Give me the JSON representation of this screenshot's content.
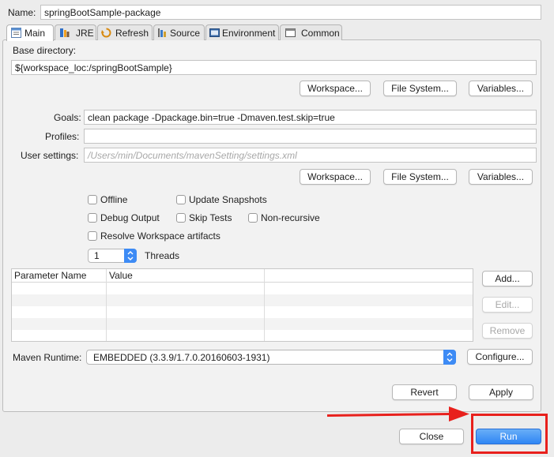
{
  "name_label": "Name:",
  "name_value": "springBootSample-package",
  "tabs": [
    {
      "label": "Main",
      "icon": "main-tab-icon"
    },
    {
      "label": "JRE",
      "icon": "jre-tab-icon"
    },
    {
      "label": "Refresh",
      "icon": "refresh-tab-icon"
    },
    {
      "label": "Source",
      "icon": "source-tab-icon"
    },
    {
      "label": "Environment",
      "icon": "environment-tab-icon"
    },
    {
      "label": "Common",
      "icon": "common-tab-icon"
    }
  ],
  "base_directory": {
    "label": "Base directory:",
    "value": "${workspace_loc:/springBootSample}",
    "buttons": [
      "Workspace...",
      "File System...",
      "Variables..."
    ]
  },
  "goals": {
    "label": "Goals:",
    "value": "clean package -Dpackage.bin=true -Dmaven.test.skip=true"
  },
  "profiles": {
    "label": "Profiles:",
    "value": ""
  },
  "user_settings": {
    "label": "User settings:",
    "placeholder": "/Users/min/Documents/mavenSetting/settings.xml",
    "buttons": [
      "Workspace...",
      "File System...",
      "Variables..."
    ]
  },
  "options": {
    "offline": "Offline",
    "update_snapshots": "Update Snapshots",
    "debug_output": "Debug Output",
    "skip_tests": "Skip Tests",
    "non_recursive": "Non-recursive",
    "resolve_workspace": "Resolve Workspace artifacts",
    "threads_value": "1",
    "threads_label": "Threads"
  },
  "parameters": {
    "columns": [
      "Parameter Name",
      "Value"
    ],
    "add": "Add...",
    "edit": "Edit...",
    "remove": "Remove"
  },
  "maven_runtime": {
    "label": "Maven Runtime:",
    "value": "EMBEDDED (3.3.9/1.7.0.20160603-1931)",
    "configure": "Configure..."
  },
  "actions": {
    "revert": "Revert",
    "apply": "Apply",
    "close": "Close",
    "run": "Run"
  },
  "colors": {
    "accent": "#2f86f4",
    "highlight": "#e8201c"
  }
}
